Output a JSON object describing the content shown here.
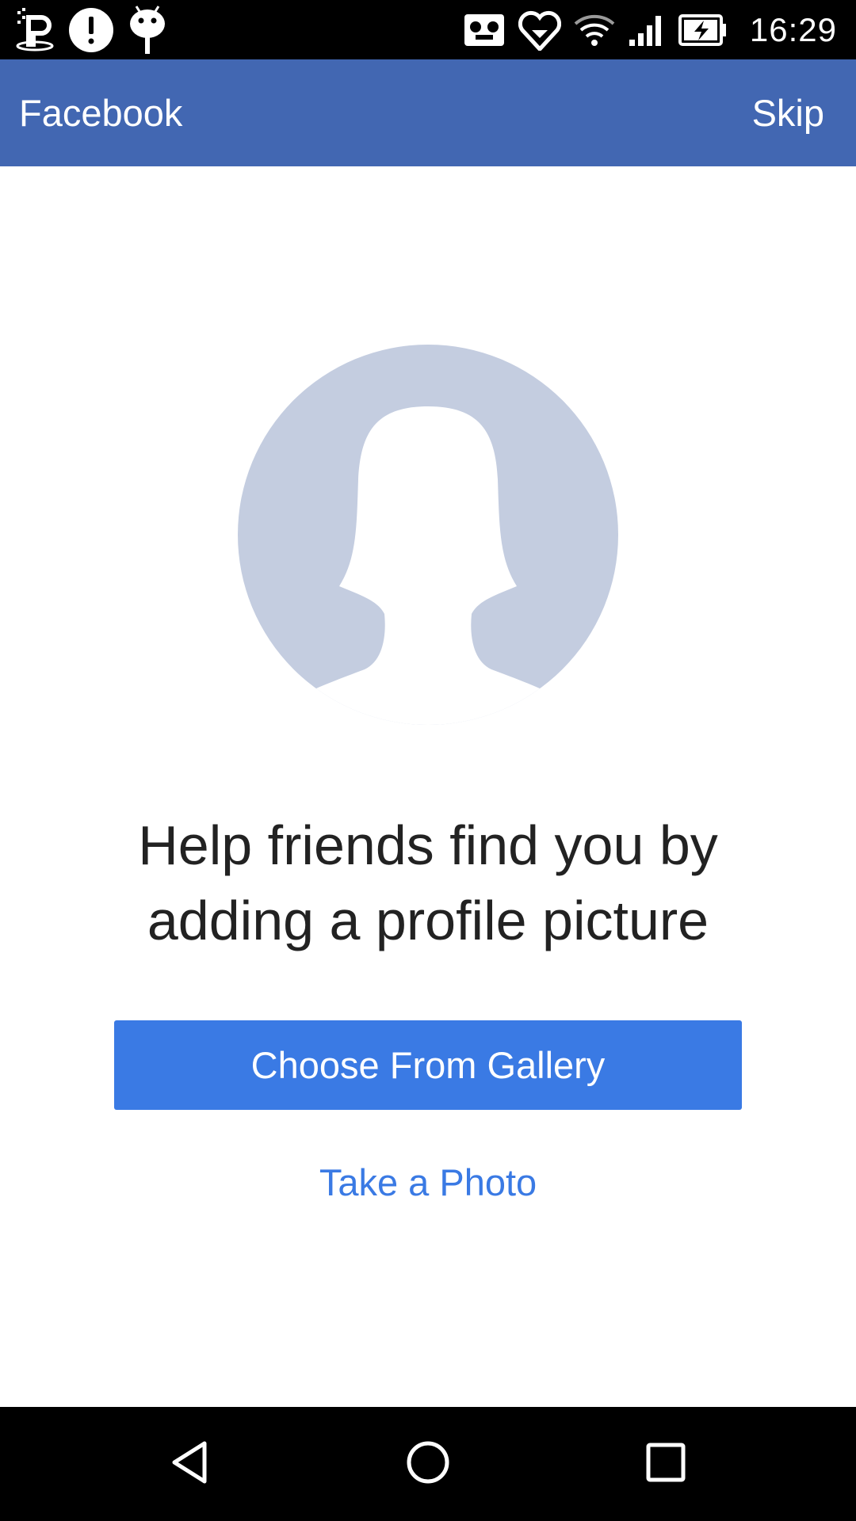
{
  "status_bar": {
    "time": "16:29",
    "left_icons": [
      "notification-p-icon",
      "alert-icon",
      "android-icon"
    ],
    "right_icons": [
      "voicemail-icon",
      "heart-shield-icon",
      "wifi-icon",
      "signal-icon",
      "battery-charging-icon"
    ]
  },
  "app_bar": {
    "title": "Facebook",
    "skip_label": "Skip",
    "background_color": "#4267b2"
  },
  "main": {
    "avatar_icon": "profile-placeholder-icon",
    "headline_line1": "Help friends find you by",
    "headline_line2": "adding a profile picture",
    "gallery_button_label": "Choose From Gallery",
    "photo_link_label": "Take a Photo",
    "accent_color": "#3a7ae4"
  },
  "nav_bar": {
    "buttons": [
      "back-icon",
      "home-icon",
      "recents-icon"
    ]
  }
}
